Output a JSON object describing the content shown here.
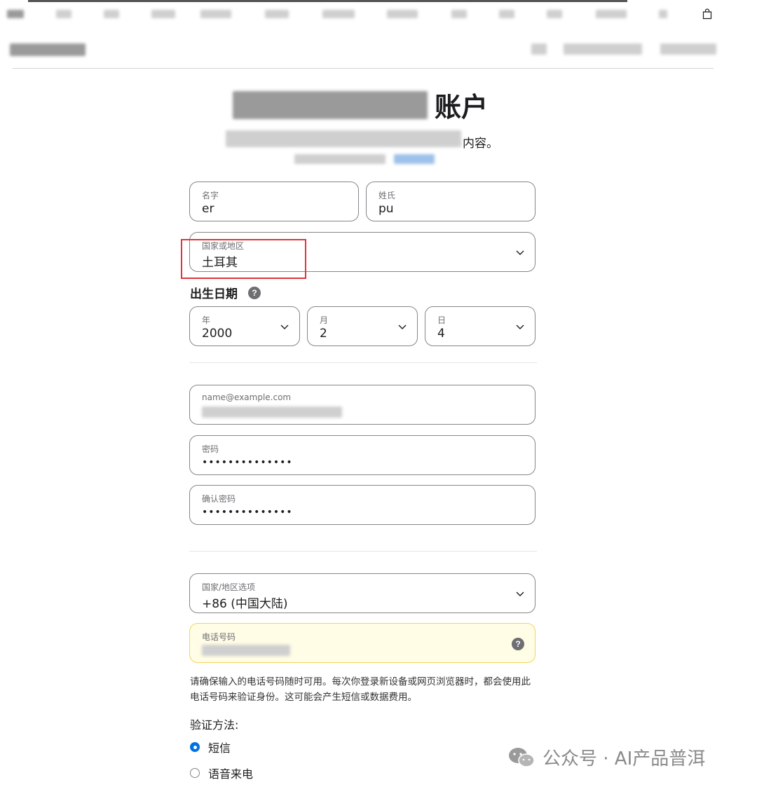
{
  "heading_tail": "账户",
  "subheading_tail": "内容。",
  "form": {
    "first_name": {
      "label": "名字",
      "value": "er"
    },
    "last_name": {
      "label": "姓氏",
      "value": "pu"
    },
    "country": {
      "label": "国家或地区",
      "value": "土耳其"
    },
    "birthdate": {
      "title": "出生日期",
      "help": "?",
      "year": {
        "label": "年",
        "value": "2000"
      },
      "month": {
        "label": "月",
        "value": "2"
      },
      "day": {
        "label": "日",
        "value": "4"
      }
    },
    "email": {
      "placeholder": "name@example.com"
    },
    "password": {
      "label": "密码",
      "value": "••••••••••••••"
    },
    "confirm_password": {
      "label": "确认密码",
      "value": "••••••••••••••"
    },
    "phone_country": {
      "label": "国家/地区选项",
      "value": "+86 (中国大陆)"
    },
    "phone_number": {
      "label": "电话号码",
      "help": "?"
    },
    "phone_note": "请确保输入的电话号码随时可用。每次你登录新设备或网页浏览器时，都会使用此电话号码来验证身份。这可能会产生短信或数据费用。",
    "verify": {
      "label": "验证方法:",
      "options": [
        "短信",
        "语音来电"
      ],
      "selected": "短信"
    }
  },
  "watermark": "公众号 · AI产品普洱",
  "colors": {
    "accent": "#0071e3",
    "highlight_box": "#e0343b",
    "phone_field_bg": "#fffde6"
  }
}
